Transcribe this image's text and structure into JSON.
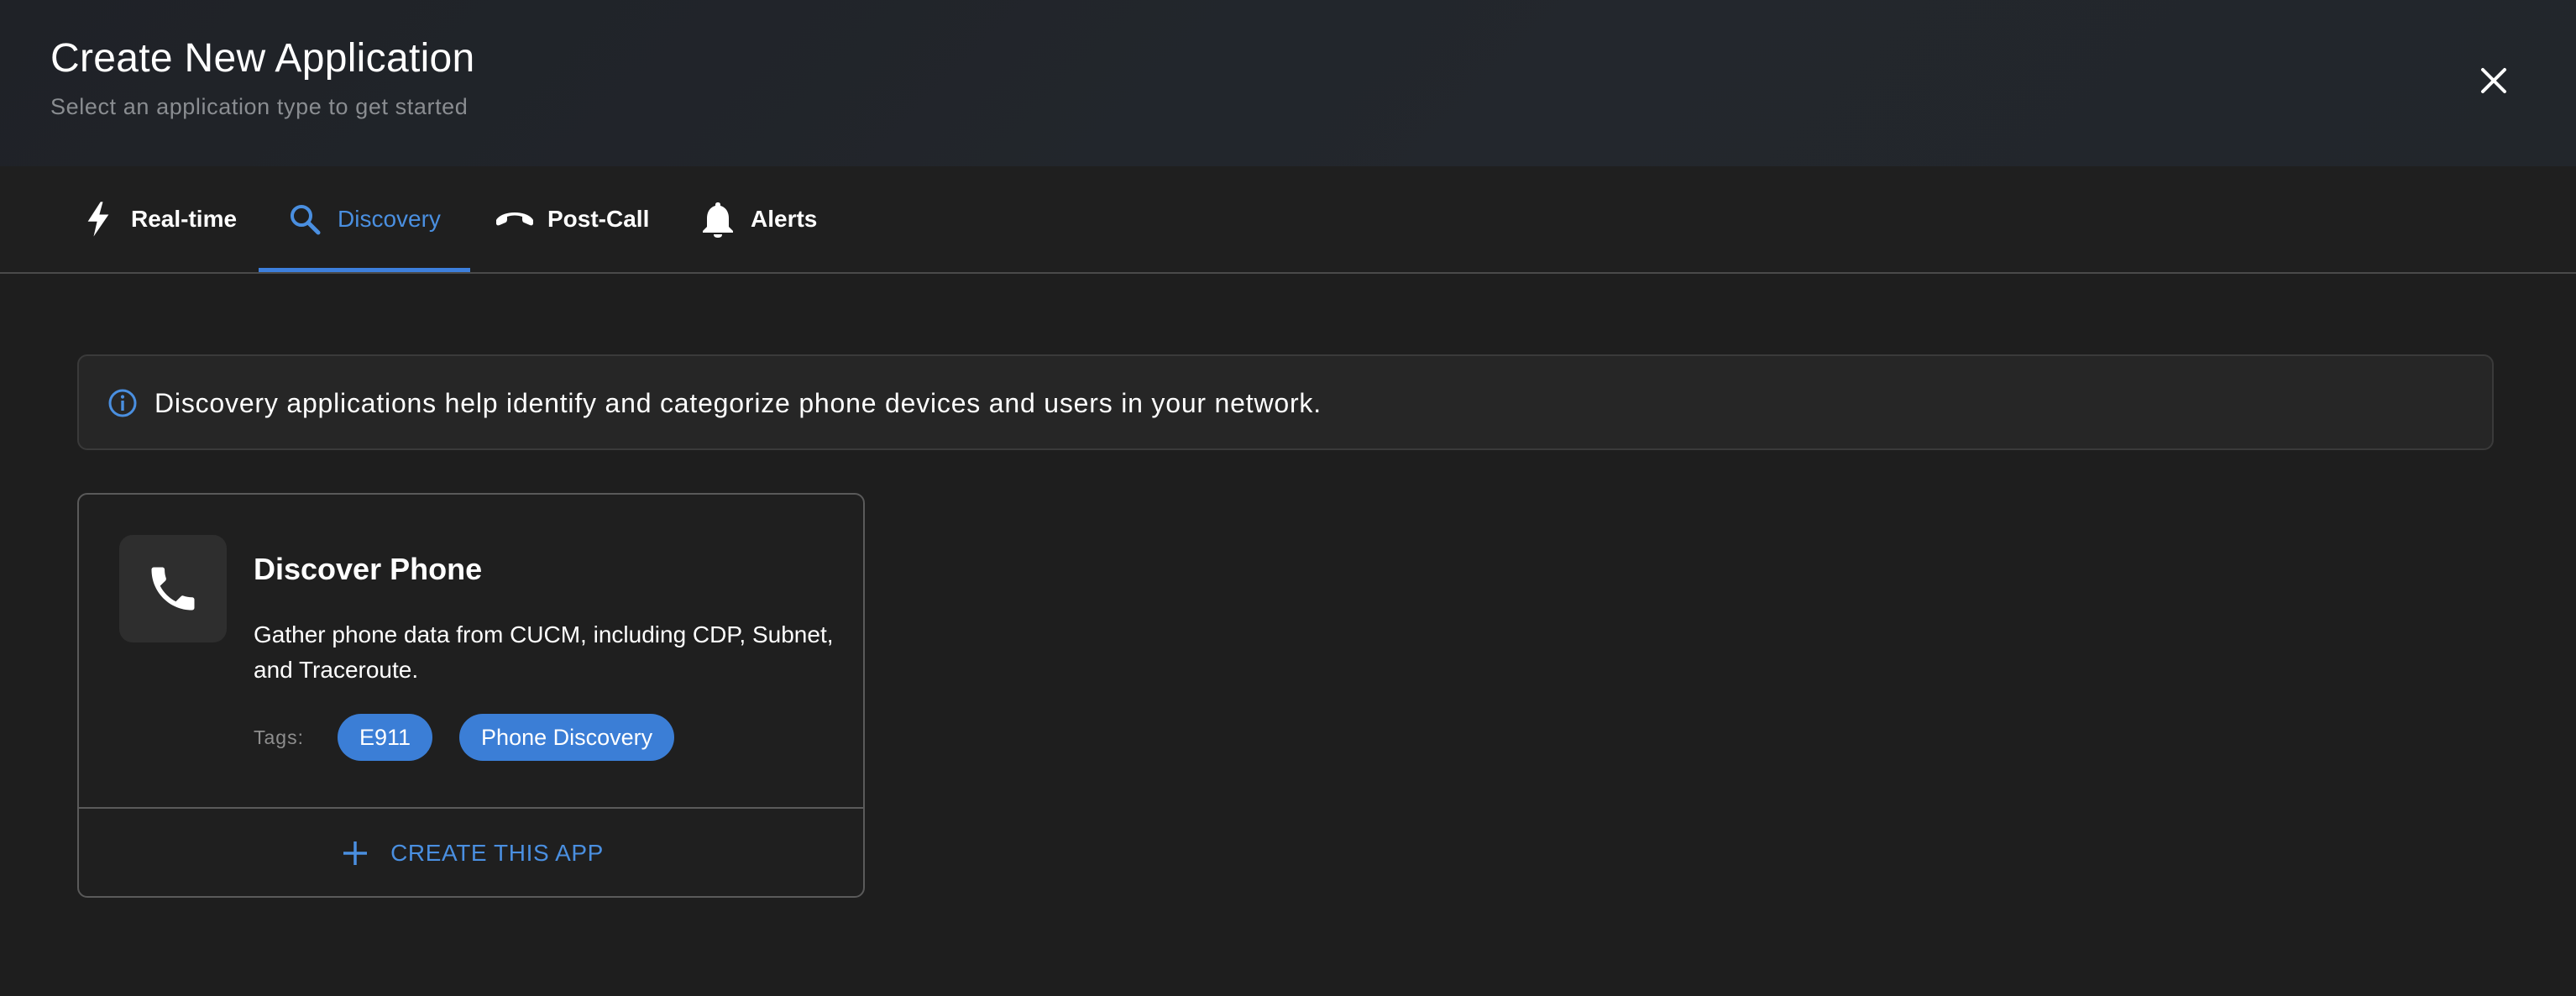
{
  "dialog": {
    "title": "Create New Application",
    "subtitle": "Select an application type to get started",
    "close_icon": "close-icon"
  },
  "tabs": [
    {
      "label": "Real-time",
      "icon": "lightning-icon",
      "active": false
    },
    {
      "label": "Discovery",
      "icon": "search-icon",
      "active": true
    },
    {
      "label": "Post-Call",
      "icon": "call-end-icon",
      "active": false
    },
    {
      "label": "Alerts",
      "icon": "bell-icon",
      "active": false
    }
  ],
  "info": {
    "icon": "info-icon",
    "text": "Discovery applications help identify and categorize phone devices and users in your network."
  },
  "card": {
    "icon": "phone-icon",
    "name": "Discover Phone",
    "description": "Gather phone data from CUCM, including CDP, Subnet, and Traceroute.",
    "tags_label": "Tags:",
    "tags": [
      "E911",
      "Phone Discovery"
    ],
    "create_label": "CREATE THIS APP"
  },
  "colors": {
    "accent": "#3b7ed6",
    "accent_text": "#4a8fe0",
    "background": "#1e1e1e",
    "header_bg": "#22252a"
  }
}
